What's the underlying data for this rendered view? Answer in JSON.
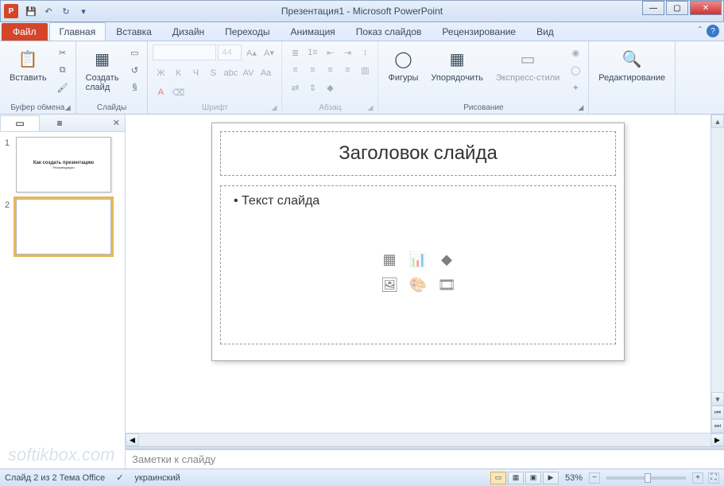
{
  "app": {
    "icon_letter": "P",
    "title": "Презентация1 - Microsoft PowerPoint"
  },
  "qat": {
    "save": "💾",
    "undo": "↶",
    "redo": "↻",
    "more": "▾"
  },
  "window_controls": {
    "minimize": "—",
    "maximize": "▢",
    "close": "✕"
  },
  "tabs": {
    "file": "Файл",
    "items": [
      "Главная",
      "Вставка",
      "Дизайн",
      "Переходы",
      "Анимация",
      "Показ слайдов",
      "Рецензирование",
      "Вид"
    ],
    "active_index": 0
  },
  "ribbon_help": {
    "minimize": "ˆ",
    "help": "?"
  },
  "ribbon": {
    "clipboard": {
      "paste": "Вставить",
      "paste_icon": "📋",
      "cut": "✂",
      "copy": "⧉",
      "format_painter": "🖌",
      "label": "Буфер обмена"
    },
    "slides": {
      "new_slide": "Создать\nслайд",
      "new_icon": "▦",
      "layout": "▭",
      "reset": "↺",
      "section": "§",
      "label": "Слайды"
    },
    "font": {
      "name_placeholder": " ",
      "size_placeholder": "44",
      "grow": "A▴",
      "shrink": "A▾",
      "bold": "Ж",
      "italic": "К",
      "underline": "Ч",
      "strike": "abc",
      "shadow": "S",
      "spacing": "AV",
      "case": "Aa",
      "color": "A",
      "clear": "⌫",
      "label": "Шрифт"
    },
    "paragraph": {
      "bullets": "≣",
      "numbering": "1≡",
      "indent_dec": "⇤",
      "indent_inc": "⇥",
      "linespacing": "↕",
      "align_l": "≡",
      "align_c": "≡",
      "align_r": "≡",
      "justify": "≡",
      "columns": "▥",
      "direction": "⇄",
      "align_v": "⇕",
      "smartart": "◆",
      "label": "Абзац"
    },
    "drawing": {
      "shapes": "Фигуры",
      "shapes_icon": "◯",
      "arrange": "Упорядочить",
      "arrange_icon": "▦",
      "quickstyles": "Экспресс-стили",
      "quick_icon": "▭",
      "fill": "◉",
      "outline": "◯",
      "effects": "✦",
      "label": "Рисование"
    },
    "editing": {
      "label_btn": "Редактирование",
      "icon": "🔍",
      "label": ""
    }
  },
  "panel": {
    "slides_tab": "▭",
    "outline_tab": "≡",
    "close": "✕"
  },
  "thumbnails": [
    {
      "num": "1",
      "title": "Как создать презентацию",
      "sub": "Рекомендации",
      "selected": false
    },
    {
      "num": "2",
      "title": "",
      "sub": "",
      "selected": true
    }
  ],
  "slide": {
    "title": "Заголовок слайда",
    "body": "Текст слайда",
    "icons": {
      "table": "▦",
      "chart": "📊",
      "smartart": "◆",
      "picture": "🖼",
      "clipart": "🎨",
      "media": "🎞"
    }
  },
  "notes": {
    "placeholder": "Заметки к слайду"
  },
  "status": {
    "slide_info": "Слайд 2 из 2   Тема Office",
    "language": "украинский",
    "spell": "✓",
    "views": {
      "normal": "▭",
      "sorter": "▦",
      "reading": "▣",
      "slideshow": "▶"
    },
    "zoom": "53%",
    "zoom_minus": "−",
    "zoom_plus": "+",
    "fit": "⛶"
  },
  "watermark": "softikbox.com"
}
